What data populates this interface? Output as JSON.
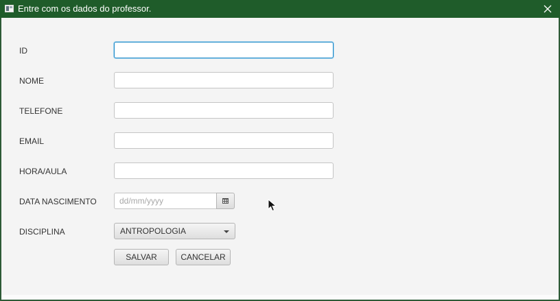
{
  "window": {
    "title": "Entre com os dados do professor.",
    "close_icon": "close-icon"
  },
  "form": {
    "id_label": "ID",
    "id_value": "",
    "nome_label": "NOME",
    "nome_value": "",
    "telefone_label": "TELEFONE",
    "telefone_value": "",
    "email_label": "EMAIL",
    "email_value": "",
    "hora_aula_label": "HORA/AULA",
    "hora_aula_value": "",
    "data_nascimento_label": "DATA NASCIMENTO",
    "data_nascimento_placeholder": "dd/mm/yyyy",
    "data_nascimento_value": "",
    "disciplina_label": "DISCIPLINA",
    "disciplina_selected": "ANTROPOLOGIA"
  },
  "buttons": {
    "save_label": "SALVAR",
    "cancel_label": "CANCELAR"
  },
  "colors": {
    "titlebar": "#1f5c2a",
    "focus_border": "#1d8ac7",
    "dialog_background": "#f4f4f4"
  }
}
